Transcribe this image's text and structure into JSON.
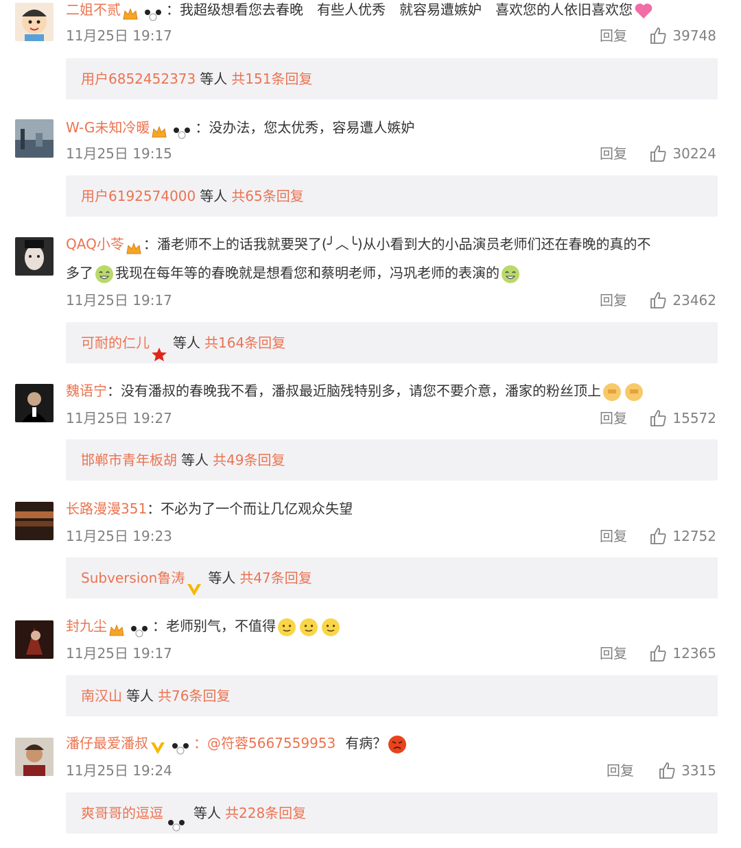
{
  "colors": {
    "username": "#eb7350",
    "meta": "#808080",
    "text": "#333333",
    "reply_panel": "#f2f2f5"
  },
  "labels": {
    "reply": "回复"
  },
  "comments": [
    {
      "user": "二姐不贰",
      "text": "：我超级想看您去春晚　有些人优秀　就容易遭嫉妒　喜欢您的人依旧喜欢您",
      "time": "11月25日 19:17",
      "likes": "39748",
      "sub_user": "用户6852452373",
      "sub_etc": "等人",
      "sub_count": "共151条回复"
    },
    {
      "user": "W-G未知冷暖",
      "text": "：没办法，您太优秀，容易遭人嫉妒",
      "time": "11月25日 19:15",
      "likes": "30224",
      "sub_user": "用户6192574000",
      "sub_etc": "等人",
      "sub_count": "共65条回复"
    },
    {
      "user": "QAQ小苓",
      "text": "：潘老师不上的话我就要哭了(╯︿╰)从小看到大的小品演员老师们还在春晚的真的不",
      "text2": "多了",
      "text3": "我现在每年等的春晚就是想看您和蔡明老师，冯巩老师的表演的",
      "time": "11月25日 19:17",
      "likes": "23462",
      "sub_user": "可耐的仁儿",
      "sub_etc": "等人",
      "sub_count": "共164条回复"
    },
    {
      "user": "魏语宁",
      "text": "：没有潘叔的春晚我不看，潘叔最近脑残特别多，请您不要介意，潘家的粉丝顶上",
      "time": "11月25日 19:27",
      "likes": "15572",
      "sub_user": "邯郸市青年板胡",
      "sub_etc": "等人",
      "sub_count": "共49条回复"
    },
    {
      "user": "长路漫漫351",
      "text": "：不必为了一个而让几亿观众失望",
      "time": "11月25日 19:23",
      "likes": "12752",
      "sub_user": "Subversion鲁涛",
      "sub_etc": "等人",
      "sub_count": "共47条回复"
    },
    {
      "user": "封九尘",
      "text": "：老师别气，不值得",
      "time": "11月25日 19:17",
      "likes": "12365",
      "sub_user": "南汉山",
      "sub_etc": "等人",
      "sub_count": "共76条回复"
    },
    {
      "user": "潘仔最爱潘叔",
      "text": "：@符蓉5667559953",
      "text2": "有病？",
      "time": "11月25日 19:24",
      "likes": "3315",
      "sub_user": "爽哥哥的逗逗",
      "sub_etc": "等人",
      "sub_count": "共228条回复"
    }
  ]
}
